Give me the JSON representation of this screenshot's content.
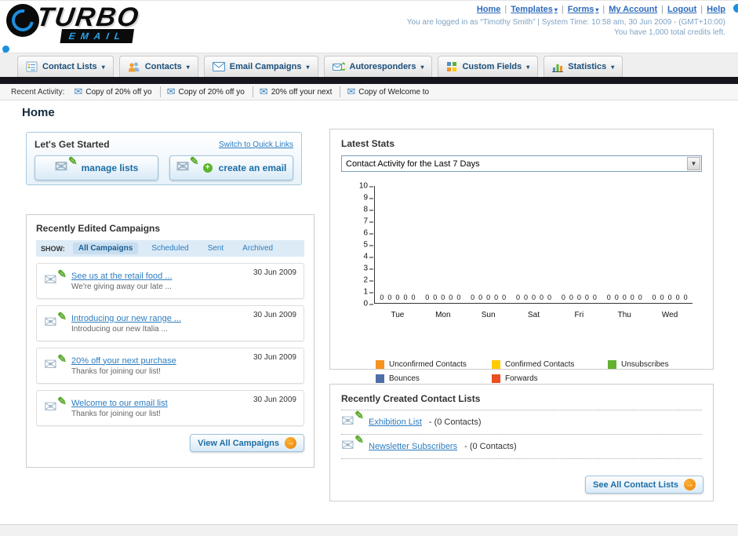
{
  "colors": {
    "link": "#2d7dc0",
    "accent_orange": "#f6921e",
    "dark_bar": "#15151d"
  },
  "header": {
    "logo_primary": "TURBO",
    "logo_secondary": "EMAIL",
    "nav": [
      {
        "label": "Home"
      },
      {
        "label": "Templates"
      },
      {
        "label": "Forms"
      },
      {
        "label": "My Account"
      },
      {
        "label": "Logout"
      },
      {
        "label": "Help"
      }
    ],
    "login_info": "You are logged in as “Timothy Smith” | System Time: 10:58 am, 30 Jun 2009 - (GMT+10:00)",
    "credits_info": "You have 1,000 total credits left."
  },
  "nav_tabs": [
    {
      "label": "Contact Lists"
    },
    {
      "label": "Contacts"
    },
    {
      "label": "Email Campaigns"
    },
    {
      "label": "Autoresponders"
    },
    {
      "label": "Custom Fields"
    },
    {
      "label": "Statistics"
    }
  ],
  "recent_activity": {
    "label": "Recent Activity:",
    "items": [
      "Copy of 20% off yo",
      "Copy of 20% off yo",
      "20% off your next",
      "Copy of Welcome to"
    ]
  },
  "main": {
    "page_title": "Home"
  },
  "get_started": {
    "title": "Let's Get Started",
    "switch_link": "Switch to Quick Links",
    "manage_button": "manage lists",
    "create_button": "create an email"
  },
  "campaigns": {
    "title": "Recently Edited Campaigns",
    "show_label": "SHOW:",
    "tabs": [
      {
        "label": "All Campaigns",
        "active": true
      },
      {
        "label": "Scheduled",
        "active": false
      },
      {
        "label": "Sent",
        "active": false
      },
      {
        "label": "Archived",
        "active": false
      }
    ],
    "items": [
      {
        "title": "See us at the retail food ...",
        "subtitle": "We're giving away our late ...",
        "date": "30 Jun 2009"
      },
      {
        "title": "Introducing our new range ...",
        "subtitle": "Introducing our new Italia ...",
        "date": "30 Jun 2009"
      },
      {
        "title": "20% off your next purchase",
        "subtitle": "Thanks for joining our list!",
        "date": "30 Jun 2009"
      },
      {
        "title": "Welcome to our email list",
        "subtitle": "Thanks for joining our list!",
        "date": "30 Jun 2009"
      }
    ],
    "view_all_label": "View All Campaigns"
  },
  "latest_stats": {
    "title": "Latest Stats",
    "dropdown_value": "Contact Activity for the Last 7 Days",
    "chart_data": {
      "type": "bar",
      "title": "Contact Activity for the Last 7 Days",
      "categories": [
        "Tue",
        "Mon",
        "Sun",
        "Sat",
        "Fri",
        "Thu",
        "Wed"
      ],
      "series": [
        {
          "name": "Unconfirmed Contacts",
          "color": "#F6921E",
          "values": [
            0,
            0,
            0,
            0,
            0,
            0,
            0
          ]
        },
        {
          "name": "Confirmed Contacts",
          "color": "#FFCB05",
          "values": [
            0,
            0,
            0,
            0,
            0,
            0,
            0
          ]
        },
        {
          "name": "Unsubscribes",
          "color": "#62B131",
          "values": [
            0,
            0,
            0,
            0,
            0,
            0,
            0
          ]
        },
        {
          "name": "Bounces",
          "color": "#4E6FA5",
          "values": [
            0,
            0,
            0,
            0,
            0,
            0,
            0
          ]
        },
        {
          "name": "Forwards",
          "color": "#EA4E21",
          "values": [
            0,
            0,
            0,
            0,
            0,
            0,
            0
          ]
        }
      ],
      "xlabel": "",
      "ylabel": "",
      "ylim": [
        0,
        10
      ],
      "grid": false,
      "legend_position": "bottom"
    }
  },
  "contact_lists": {
    "title": "Recently Created Contact Lists",
    "items": [
      {
        "name": "Exhibition List",
        "count_text": "- (0 Contacts)"
      },
      {
        "name": "Newsletter Subscribers",
        "count_text": "- (0 Contacts)"
      }
    ],
    "see_all_label": "See All Contact Lists"
  }
}
